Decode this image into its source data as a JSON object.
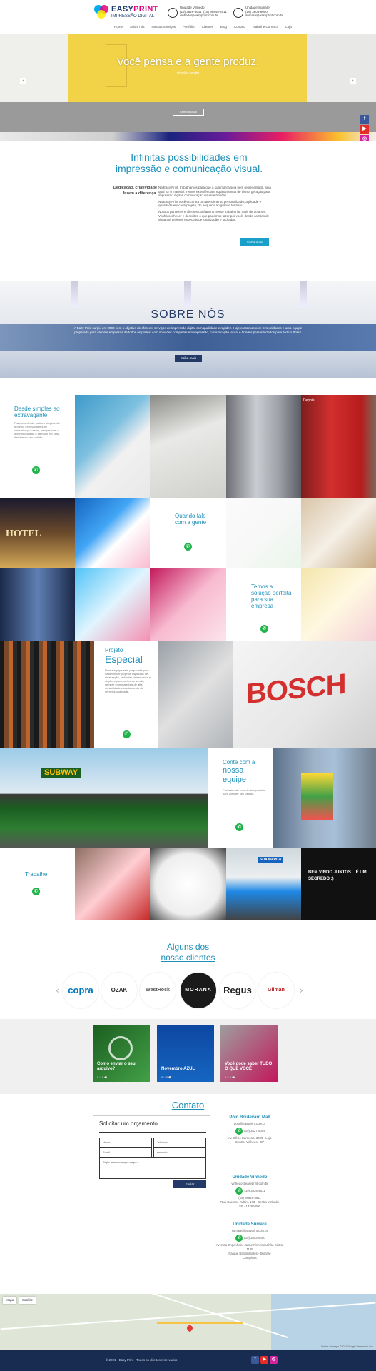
{
  "header": {
    "logo_line1": "EASY",
    "logo_line1b": "PRINT",
    "logo_line2": "IMPRESSÃO DIGITAL",
    "units": [
      {
        "text": "Unidade Vinhedo\n(19) 3826-4611  (19) 98845-4911\nvinhedo@easyprint.com.br"
      },
      {
        "text": "Unidade Sumaré\n(19) 3803-6000\nsumare@easyprint.com.br"
      }
    ],
    "nav": [
      "Home",
      "Sobre nós",
      "Nossos Serviços",
      "Portfólio",
      "Clientes",
      "Blog",
      "Contato",
      "Trabalhe Conosco",
      "Loja"
    ]
  },
  "hero": {
    "title": "Você pensa e a gente produz.",
    "subtitle": "simples assim",
    "button": "Fale conosco",
    "prev": "‹",
    "next": "›"
  },
  "social": {
    "facebook": "f",
    "youtube": "▶",
    "instagram": "◎"
  },
  "intro": {
    "title": "Infinitas possibilidades em impressão e comunicação visual.",
    "left": "Dedicação, criatividade fazem a diferença.",
    "paragraphs": [
      "Na Easy Print, trabalhamos para que a sua marca seja bem representada, seja qual for o material. Temos experiência e equipamentos de última geração para impressão digital, comunicação visual e brindes.",
      "Na Easy Print você encontra um atendimento personalizado, agilidade e qualidade em cada projeto, do pequeno ao grande formato.",
      "Nossos parceiros e clientes confiam no nosso trabalho há mais de 10 anos. Venha conhecer e descubra o que podemos fazer por você, desde cartões de visita até projetos especiais de sinalização e fachadas."
    ],
    "button": "Saiba mais"
  },
  "about": {
    "title": "SOBRE NÓS",
    "text": "A Easy Print surgiu em 2008 com o objetivo de oferecer serviços de impressão digital com qualidade e rapidez. Hoje contamos com três unidades e uma equipe preparada para atender empresas de todos os portes, com soluções completas em impressão, comunicação visual e brindes personalizados para todo o Brasil.",
    "button": "Saiba mais"
  },
  "gallery": {
    "t1_title": "Desde simples ao extravagante",
    "t1_body": "Fazemos desde cartões simples até projetos extravagantes de comunicação visual, sempre com o mesmo cuidado e atenção em cada detalhe do seu pedido.",
    "t2_title": "Quando falo com a gente",
    "t3_title": "Temos a solução perfeita para sua empresa",
    "t4_title1": "Projeto",
    "t4_title2": "Especial",
    "t4_body": "Nossa equipe está preparada para desenvolver projetos especiais de sinalização, fachadas, letras caixa e displays para pontos de venda, sempre com materiais de alta durabilidade e acabamento de primeira qualidade.",
    "t5_title1": "Conte com a",
    "t5_title2": "nossa",
    "t5_title3": "equipe",
    "t5_body": "Profissionais experientes prontos para atender seu pedido.",
    "t6_title": "Trabalhe",
    "depois": "Depois",
    "fridge_text": "",
    "bosch": "BOSCH",
    "subway": "SUBWAY",
    "hotel": "HOTEL",
    "van": "SUA MARCA",
    "wall": "BEM VINDO JUNTOS... É UM SEGREDO :)"
  },
  "clients": {
    "title1": "Alguns dos",
    "title2": "nosso clientes",
    "logos": [
      "copra",
      "OZAK",
      "WestRock",
      "MORANA",
      "Regus",
      "Gilman"
    ],
    "prev": "‹",
    "next": "›"
  },
  "blog": {
    "posts": [
      {
        "title": "Como enviar o seu arquivo?",
        "meta": "0 ♡  0 💬"
      },
      {
        "title": "Novembro AZUL",
        "meta": "0 ♡  0 💬"
      },
      {
        "title": "Você pode saber TUDO O QUE VOCÊ",
        "meta": "0 ♡  0 💬"
      }
    ]
  },
  "contact": {
    "title": "Contato",
    "form_title": "Solicitar um orçamento",
    "fields": [
      "Nome",
      "Telefone",
      "Email",
      "Assunto",
      "Digite sua mensagem aqui..."
    ],
    "submit": "Enviar",
    "addresses": [
      {
        "title": "Pólo Boulevard Mall",
        "lines": [
          "polo@easyprint.com.br",
          "(19) 3827-6004",
          "Av. Olívio Carmona, 3000 - Loja",
          "Centro, Vinhedo - SP"
        ]
      },
      {
        "title": "Unidade Vinhedo",
        "lines": [
          "vinhedo@easyprint.com.br",
          "(19) 3826-4611",
          "(19) 98845-4911",
          "Rua Caetano Rubini, 173 - Centro Vinhedo",
          "SP - 13280-000"
        ]
      },
      {
        "title": "Unidade Sumaré",
        "lines": [
          "sumare@easyprint.com.br",
          "(19) 3803-6000",
          "Avenida Engenheiro Jaime Pinheiro Ulhôa Cintra, 1185",
          "Parque Bandeirantes - Sumaré",
          "Campinas"
        ]
      }
    ]
  },
  "map": {
    "tab1": "Mapa",
    "tab2": "Satélite",
    "credit": "Dados do mapa ©2021 Google  Termos de Uso"
  },
  "footer": {
    "text": "© 2021 · Easy Print · Todos os direitos reservados",
    "fb": "f",
    "yt": "▶",
    "ig": "◎"
  },
  "colors": {
    "accent": "#1d8fb9",
    "navy": "#233a66",
    "whatsapp": "#21b34a"
  }
}
